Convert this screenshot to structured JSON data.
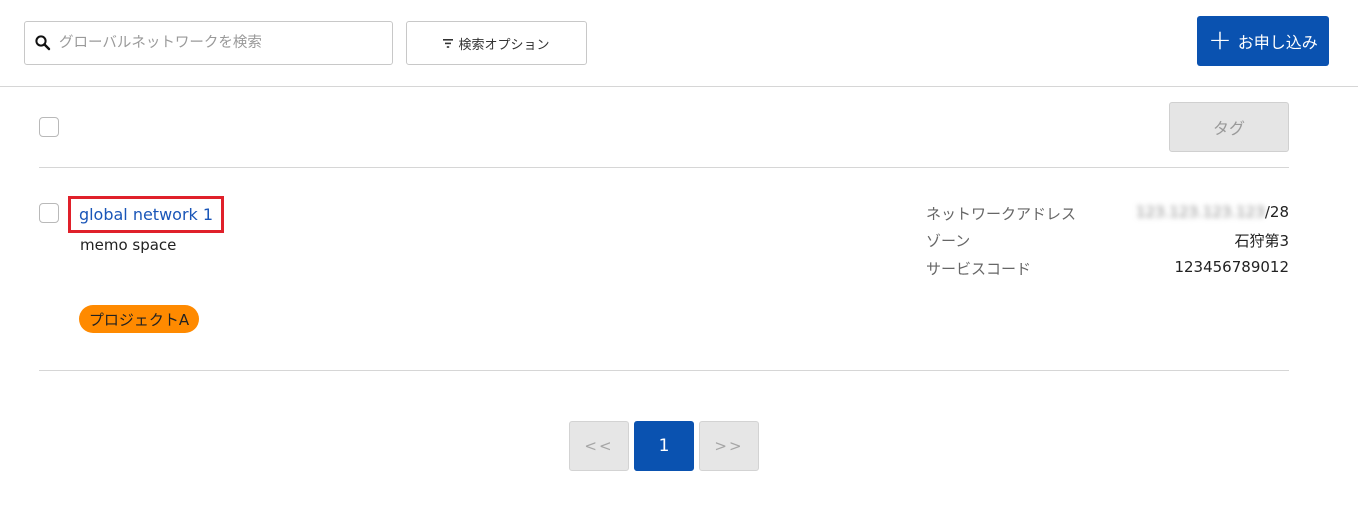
{
  "search": {
    "placeholder": "グローバルネットワークを検索",
    "value": ""
  },
  "toolbar": {
    "filter_icon": "filter-icon",
    "search_options_label": "検索オプション",
    "apply_plus": "+",
    "apply_label": "お申し込み"
  },
  "list": {
    "tag_button_label": "タグ",
    "items": [
      {
        "title": "global network 1",
        "memo": "memo space",
        "tag": "プロジェクトA",
        "details": [
          {
            "label": "ネットワークアドレス",
            "value_blurred": "123.123.123.123",
            "value_suffix": "/28"
          },
          {
            "label": "ゾーン",
            "value": "石狩第3"
          },
          {
            "label": "サービスコード",
            "value": "123456789012"
          }
        ]
      }
    ]
  },
  "pagination": {
    "prev_label": "<<",
    "current_page": "1",
    "next_label": ">>"
  },
  "colors": {
    "primary": "#0a52b0",
    "highlight_border": "#e0202a",
    "tag_orange": "#ff8a00",
    "link": "#1a56b8"
  }
}
